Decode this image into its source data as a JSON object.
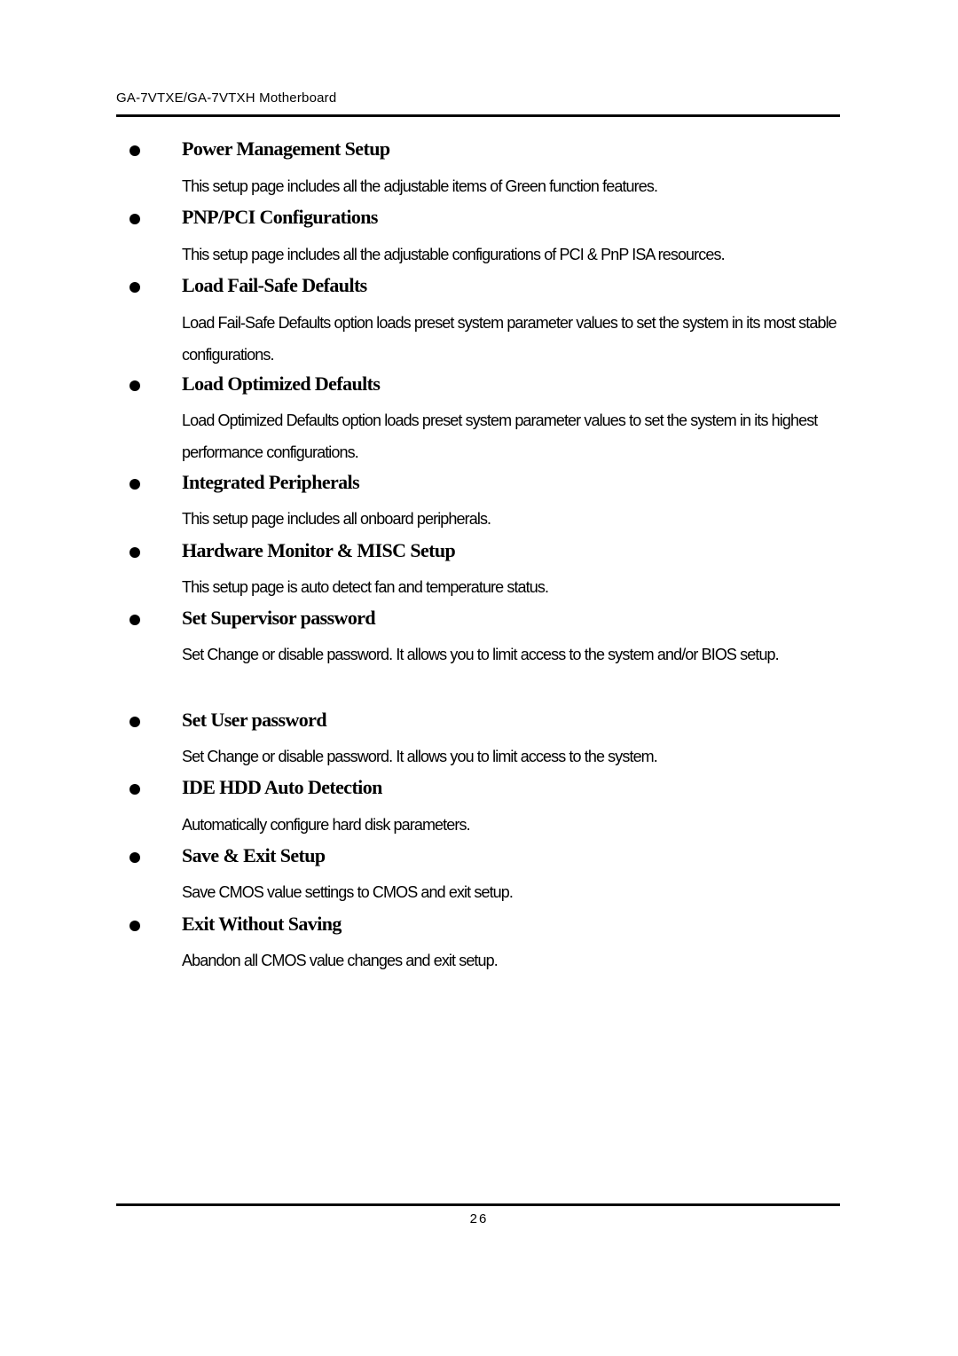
{
  "header": {
    "title": "GA-7VTXE/GA-7VTXH Motherboard"
  },
  "sections": [
    {
      "title": "Power Management Setup",
      "description": "This setup page includes all the adjustable items of Green function features."
    },
    {
      "title": "PNP/PCI Configurations",
      "description": "This setup page includes all the adjustable configurations of PCI & PnP ISA resources."
    },
    {
      "title": "Load Fail-Safe Defaults",
      "description": "Load Fail-Safe Defaults option loads preset system parameter values to set the system in its most stable configurations."
    },
    {
      "title": "Load Optimized Defaults",
      "description": "Load Optimized Defaults option loads preset system parameter values to set the system in its highest performance configurations."
    },
    {
      "title": "Integrated Peripherals",
      "description": "This setup page includes all onboard peripherals."
    },
    {
      "title": "Hardware Monitor & MISC Setup",
      "description": "This setup page is auto detect fan and temperature status."
    },
    {
      "title": "Set Supervisor password",
      "description": "Set Change or disable password. It allows you to limit access to the system and/or BIOS setup."
    },
    {
      "title": "Set User password",
      "description": "Set Change or disable password. It allows you to limit access to the system."
    },
    {
      "title": "IDE HDD Auto Detection",
      "description": "Automatically configure hard disk parameters."
    },
    {
      "title": "Save & Exit Setup",
      "description": "Save CMOS value settings to CMOS and exit setup."
    },
    {
      "title": "Exit Without Saving",
      "description": "Abandon all CMOS value changes and exit setup."
    }
  ],
  "footer": {
    "page_number": "26"
  }
}
